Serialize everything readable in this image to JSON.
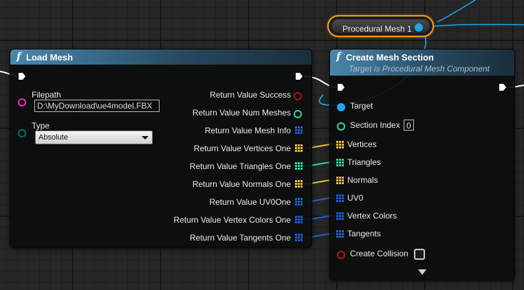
{
  "colors": {
    "exec": "#ffffff",
    "bool_pin": "#8a0b0b",
    "int_pin": "#2fd9a8",
    "object_pin": "#1ea5f0",
    "string_pin": "#ff21c8",
    "enum_pin": "#007064",
    "vector_array_pin": "#f2c03c",
    "int_array_pin": "#2fd9a8",
    "struct_array_pin": "#1f5fd6",
    "var_node_outline": "#f29b1c",
    "header_blue": "#4a87ad"
  },
  "load_mesh_node": {
    "icon": "function-icon",
    "title": "Load Mesh",
    "inputs": {
      "filepath": {
        "label": "Filepath",
        "value": "D:\\MyDownload\\ue4model.FBX"
      },
      "type": {
        "label": "Type",
        "value": "Absolute"
      }
    },
    "outputs": [
      {
        "label": "Return Value Success",
        "pin": "bool"
      },
      {
        "label": "Return Value Num Meshes",
        "pin": "int"
      },
      {
        "label": "Return Value Mesh Info",
        "pin": "struct-array"
      },
      {
        "label": "Return Value Vertices One",
        "pin": "vector-array"
      },
      {
        "label": "Return Value Triangles One",
        "pin": "int-array"
      },
      {
        "label": "Return Value Normals One",
        "pin": "vector-array"
      },
      {
        "label": "Return Value UV0One",
        "pin": "struct-array"
      },
      {
        "label": "Return Value Vertex Colors One",
        "pin": "struct-array"
      },
      {
        "label": "Return Value Tangents One",
        "pin": "struct-array"
      }
    ]
  },
  "variable_node": {
    "label": "Procedural Mesh 1"
  },
  "create_mesh_section_node": {
    "icon": "function-icon",
    "title": "Create Mesh Section",
    "subtitle": "Target is Procedural Mesh Component",
    "inputs": {
      "target": {
        "label": "Target"
      },
      "section_index": {
        "label": "Section Index",
        "value": "0"
      },
      "vertices": {
        "label": "Vertices"
      },
      "triangles": {
        "label": "Triangles"
      },
      "normals": {
        "label": "Normals"
      },
      "uv0": {
        "label": "UV0"
      },
      "vertex_colors": {
        "label": "Vertex Colors"
      },
      "tangents": {
        "label": "Tangents"
      },
      "create_collision": {
        "label": "Create Collision",
        "checked": false
      }
    }
  }
}
